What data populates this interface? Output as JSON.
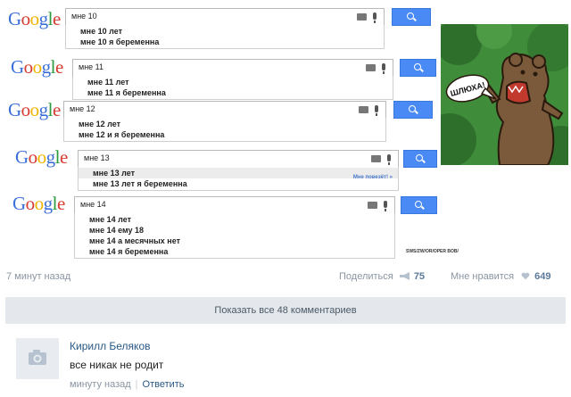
{
  "meme": {
    "searches": [
      {
        "query": "мне 10",
        "suggestions": [
          "мне 10 лет",
          "мне 10 я беременна"
        ],
        "highlight": -1,
        "lucky": ""
      },
      {
        "query": "мне 11",
        "suggestions": [
          "мне 11 лет",
          "мне 11 я беременна"
        ],
        "highlight": -1,
        "lucky": ""
      },
      {
        "query": "мне 12",
        "suggestions": [
          "мне 12 лет",
          "мне 12 и я беременна"
        ],
        "highlight": -1,
        "lucky": ""
      },
      {
        "query": "мне 13",
        "suggestions": [
          "мне 13 лет",
          "мне 13 лет я беременна"
        ],
        "highlight": 0,
        "lucky": "Мне повезёт! »"
      },
      {
        "query": "мне 14",
        "suggestions": [
          "мне 14 лет",
          "мне 14 ему 18",
          "мне 14 а месячных нет",
          "мне 14 я беременна"
        ],
        "highlight": -1,
        "lucky": ""
      }
    ],
    "logo_text": "Google",
    "bear_speech": "ШЛЮХА!",
    "credit": "SWS/ZW/OR/OPER BOB/"
  },
  "post": {
    "time": "7 минут назад",
    "share_label": "Поделиться",
    "share_count": "75",
    "like_label": "Мне нравится",
    "like_count": "649",
    "show_all_comments": "Показать все 48 комментариев"
  },
  "comment": {
    "author": "Кирилл Беляков",
    "text": "все никак не родит",
    "time": "минуту назад",
    "reply_label": "Ответить"
  },
  "colors": {
    "google_blue": "#4a8af4",
    "vk_link": "#2a5885",
    "muted": "#8a96a3",
    "show_all_bg": "#e4e8ec"
  }
}
